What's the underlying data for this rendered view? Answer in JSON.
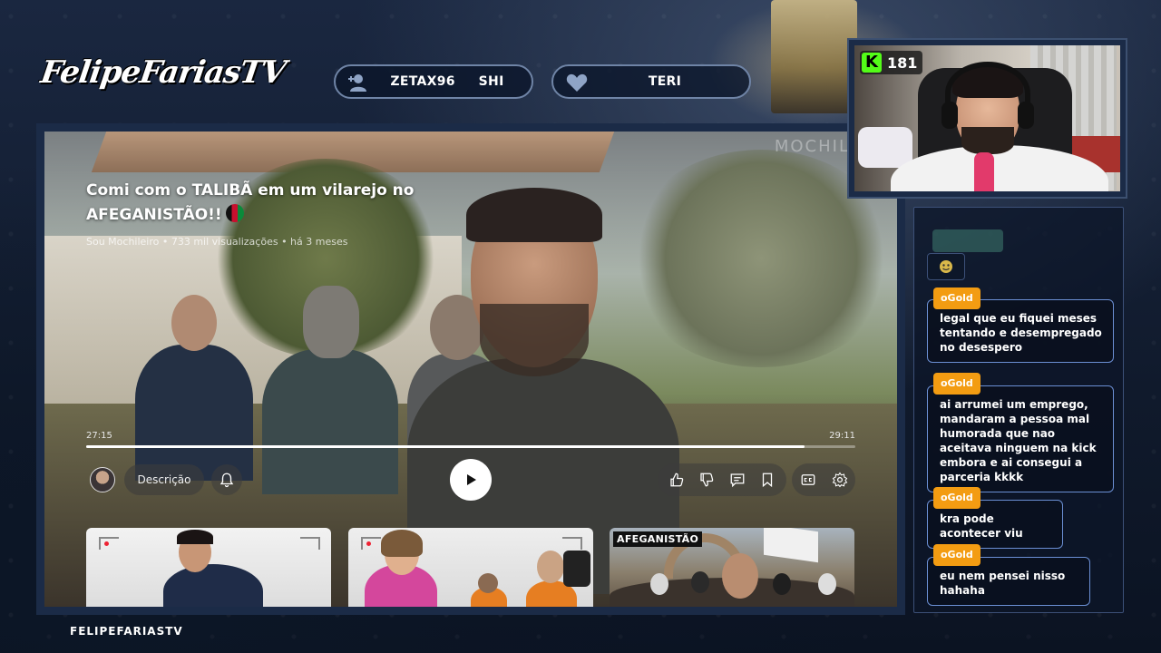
{
  "overlay": {
    "logo_text": "FelipeFariasTV",
    "footer_brand": "FELIPEFARIASTV",
    "follower_pill": {
      "icon": "user-plus-icon",
      "label": "ZETAX96",
      "suffix": "SHI"
    },
    "subscriber_pill": {
      "icon": "heart-icon",
      "label": "TERI"
    },
    "accent_color": "#6b8fd4",
    "frame_color": "#1b2b47"
  },
  "video": {
    "title_line1": "Comi com o TALIBÃ em um vilarejo no",
    "title_line2": "AFEGANISTÃO!!",
    "meta": "Sou Mochileiro • 733 mil visualizações • há 3 meses",
    "watermark": "MOCHIL",
    "current_time": "27:15",
    "duration": "29:11",
    "progress_fraction": 0.934,
    "description_label": "Descrição",
    "controls": [
      "like-icon",
      "dislike-icon",
      "comment-icon",
      "save-icon",
      "captions-icon",
      "settings-icon"
    ]
  },
  "thumbnails": [
    {
      "tag": ""
    },
    {
      "tag": ""
    },
    {
      "tag": "AFEGANISTÃO"
    }
  ],
  "webcam": {
    "platform": "kick",
    "viewer_count": "181"
  },
  "chat": {
    "messages": [
      {
        "badge": "oGold",
        "text": "legal que eu fiquei meses tentando e desempregado no desespero"
      },
      {
        "badge": "oGold",
        "text": "ai arrumei um emprego, mandaram a pessoa mal humorada que nao aceitava ninguem na kick embora e ai consegui a parceria kkkk"
      },
      {
        "badge": "oGold",
        "text": "kra pode acontecer viu"
      },
      {
        "badge": "oGold",
        "text": "eu nem pensei nisso hahaha"
      }
    ],
    "badge_color": "#f39c12"
  }
}
